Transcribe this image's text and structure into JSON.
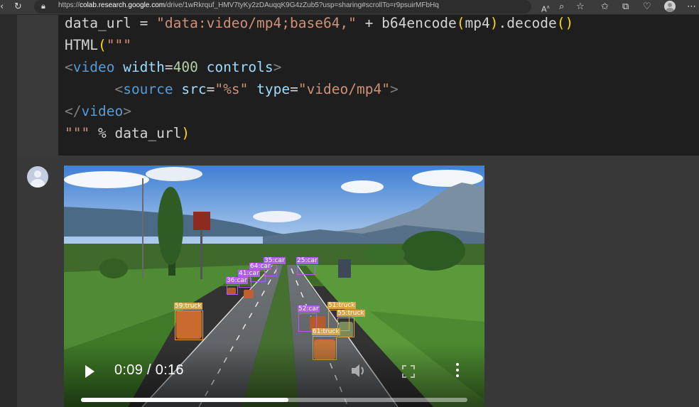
{
  "browser": {
    "url_prefix": "https://",
    "url_host": "colab.research.google.com",
    "url_path": "/drive/1wRkrquf_HMV7tyKy2zDAuqqK9G4zZub5?usp=sharing#scrollTo=r9psuirMFbHq",
    "icons": [
      "back-icon",
      "refresh-icon",
      "lock-icon",
      "read-aloud-icon",
      "zoom-icon",
      "add-favorite-icon",
      "favorites-icon",
      "collections-icon",
      "health-icon",
      "profile-icon",
      "more-icon"
    ]
  },
  "code": {
    "lines": [
      [
        [
          "plain",
          "data_url = "
        ],
        [
          "str",
          "\"data:video/mp4;base64,\""
        ],
        [
          "plain",
          " + b64encode"
        ],
        [
          "br",
          "("
        ],
        [
          "plain",
          "mp4"
        ],
        [
          "br",
          ")"
        ],
        [
          "plain",
          ".decode"
        ],
        [
          "br",
          "()"
        ]
      ],
      [
        [
          "plain",
          "HTML"
        ],
        [
          "br",
          "("
        ],
        [
          "str",
          "\"\"\""
        ]
      ],
      [
        [
          "tag",
          "<"
        ],
        [
          "tn",
          "video"
        ],
        [
          "plain",
          " "
        ],
        [
          "at",
          "width"
        ],
        [
          "plain",
          "="
        ],
        [
          "num",
          "400"
        ],
        [
          "plain",
          " "
        ],
        [
          "at",
          "controls"
        ],
        [
          "tag",
          ">"
        ]
      ],
      [
        [
          "plain",
          "      "
        ],
        [
          "tag",
          "<"
        ],
        [
          "tn",
          "source"
        ],
        [
          "plain",
          " "
        ],
        [
          "at",
          "src"
        ],
        [
          "plain",
          "="
        ],
        [
          "str",
          "\"%s\""
        ],
        [
          "plain",
          " "
        ],
        [
          "at",
          "type"
        ],
        [
          "plain",
          "="
        ],
        [
          "str",
          "\"video/mp4\""
        ],
        [
          "tag",
          ">"
        ]
      ],
      [
        [
          "tag",
          "</"
        ],
        [
          "tn",
          "video"
        ],
        [
          "tag",
          ">"
        ]
      ],
      [
        [
          "str",
          "\"\"\""
        ],
        [
          "plain",
          " % data_url"
        ],
        [
          "br",
          ")"
        ]
      ]
    ]
  },
  "video": {
    "time": "0:09 / 0:16",
    "progress": 0.536,
    "controls": [
      "play-icon",
      "volume-icon",
      "fullscreen-icon",
      "more-options-icon"
    ],
    "detections": [
      {
        "label": "35:car",
        "color": "#b05cf0"
      },
      {
        "label": "25:car",
        "color": "#b05cf0"
      },
      {
        "label": "64:car",
        "color": "#b05cf0"
      },
      {
        "label": "41:car",
        "color": "#b05cf0"
      },
      {
        "label": "36:car",
        "color": "#b05cf0"
      },
      {
        "label": "59:truck",
        "color": "#d9a441"
      },
      {
        "label": "52:car",
        "color": "#b05cf0"
      },
      {
        "label": "51:truck",
        "color": "#d9a441"
      },
      {
        "label": "55:truck",
        "color": "#d9a441"
      },
      {
        "label": "61:truck",
        "color": "#d9a441"
      }
    ]
  }
}
